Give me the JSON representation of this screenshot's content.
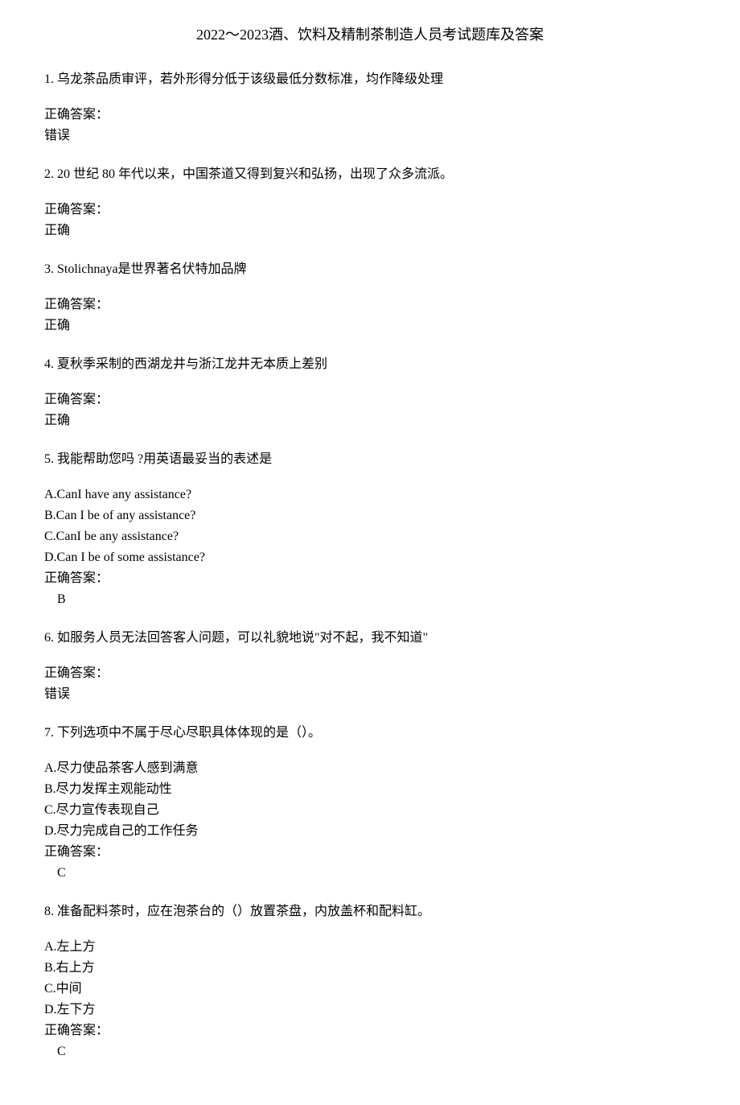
{
  "title": "2022～2023酒、饮料及精制茶制造人员考试题库及答案",
  "answerLabel": "正确答案：",
  "questions": [
    {
      "number": "1.",
      "text": "乌龙茶品质审评，若外形得分低于该级最低分数标准，均作降级处理",
      "options": [],
      "answer": "错误",
      "indented": false
    },
    {
      "number": "2.",
      "text": "20 世纪 80 年代以来，中国茶道又得到复兴和弘扬，出现了众多流派。",
      "options": [],
      "answer": "正确",
      "indented": false
    },
    {
      "number": "3.",
      "text": "Stolichnaya是世界著名伏特加品牌",
      "options": [],
      "answer": "正确",
      "indented": false
    },
    {
      "number": "4.",
      "text": "夏秋季采制的西湖龙井与浙江龙井无本质上差别",
      "options": [],
      "answer": "正确",
      "indented": false
    },
    {
      "number": "5.",
      "text": "我能帮助您吗 ?用英语最妥当的表述是",
      "options": [
        "A.CanI have any assistance?",
        "B.Can I be of any assistance?",
        "C.CanI be any assistance?",
        "D.Can I be of some assistance?"
      ],
      "answer": "B",
      "indented": true
    },
    {
      "number": "6.",
      "text": "如服务人员无法回答客人问题，可以礼貌地说\"对不起，我不知道\"",
      "options": [],
      "answer": "错误",
      "indented": false
    },
    {
      "number": "7.",
      "text": "下列选项中不属于尽心尽职具体体现的是（）。",
      "options": [
        "A.尽力使品茶客人感到满意",
        "B.尽力发挥主观能动性",
        "C.尽力宣传表现自己",
        "D.尽力完成自己的工作任务"
      ],
      "answer": "C",
      "indented": true
    },
    {
      "number": "8.",
      "text": "准备配料茶时，应在泡茶台的（）放置茶盘，内放盖杯和配料缸。",
      "options": [
        "A.左上方",
        "B.右上方",
        "C.中间",
        "D.左下方"
      ],
      "answer": "C",
      "indented": true
    }
  ]
}
